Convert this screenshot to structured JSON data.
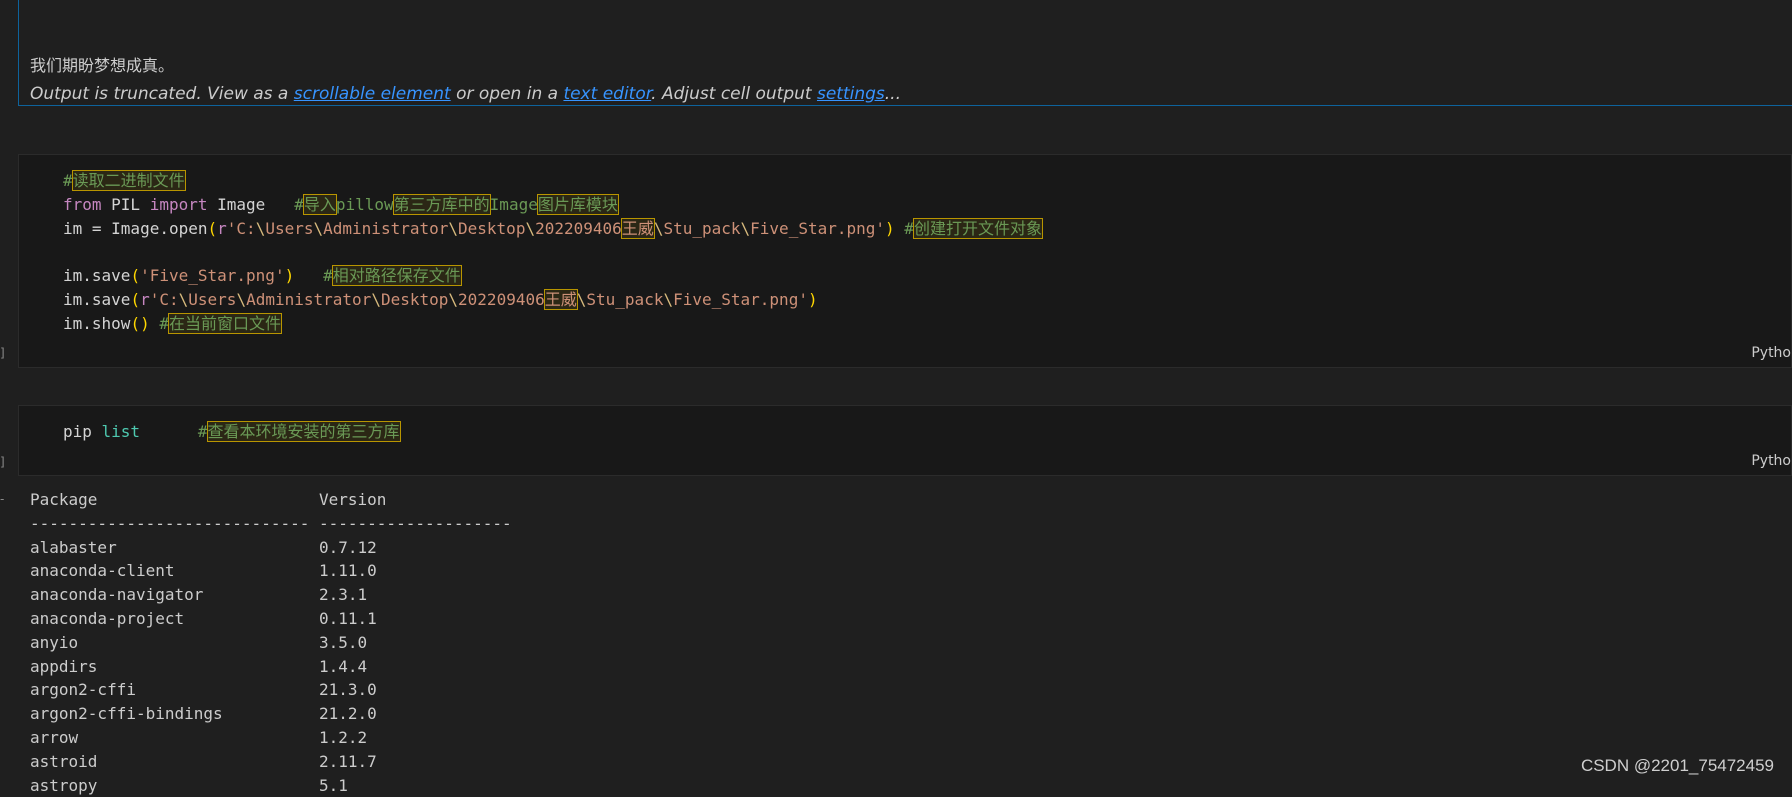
{
  "output_top": {
    "text": "我们期盼梦想成真。",
    "truncated": {
      "prefix": "Output is truncated. View as a ",
      "link1": "scrollable element",
      "mid1": " or open in a ",
      "link2": "text editor",
      "mid2": ". Adjust cell output ",
      "link3": "settings",
      "suffix": "..."
    }
  },
  "cell1": {
    "language": "Pytho",
    "bracket": "]",
    "comment1": "读取二进制文件",
    "kw_from": "from",
    "mod_pil": " PIL ",
    "kw_import": "import",
    "cls_image": " Image   ",
    "c2a": "导入",
    "c2b": "pillow",
    "c2c": "第三方库中的",
    "c2d": "Image",
    "c2e": "图片库模块",
    "l3_pre": "im = Image.open",
    "l3_r": "r",
    "l3_s1": "'C:",
    "l3_s2": "Users",
    "l3_s3": "Administrator",
    "l3_s4": "Desktop",
    "l3_s5": "202209406",
    "l3_cn": "王威",
    "l3_s6": "Stu_pack",
    "l3_s7": "Five_Star.png'",
    "l3_comment": "创建打开文件对象",
    "l4_pre": "im.save",
    "l4_str": "'Five_Star.png'",
    "l4_comment": "相对路径保存文件",
    "l5_pre": "im.save",
    "l6_pre": "im.show",
    "l6_comment": "在当前窗口文件"
  },
  "cell2": {
    "language": "Pytho",
    "bracket": "]",
    "cmd": "pip ",
    "arg": "list",
    "comment": "查看本环境安装的第三方库"
  },
  "packages": {
    "header": [
      "Package",
      "Version"
    ],
    "sep": [
      "-----------------------------",
      "--------------------"
    ],
    "rows": [
      [
        "alabaster",
        "0.7.12"
      ],
      [
        "anaconda-client",
        "1.11.0"
      ],
      [
        "anaconda-navigator",
        "2.3.1"
      ],
      [
        "anaconda-project",
        "0.11.1"
      ],
      [
        "anyio",
        "3.5.0"
      ],
      [
        "appdirs",
        "1.4.4"
      ],
      [
        "argon2-cffi",
        "21.3.0"
      ],
      [
        "argon2-cffi-bindings",
        "21.2.0"
      ],
      [
        "arrow",
        "1.2.2"
      ],
      [
        "astroid",
        "2.11.7"
      ],
      [
        "astropy",
        "5.1"
      ]
    ]
  },
  "watermark": "CSDN @2201_75472459"
}
